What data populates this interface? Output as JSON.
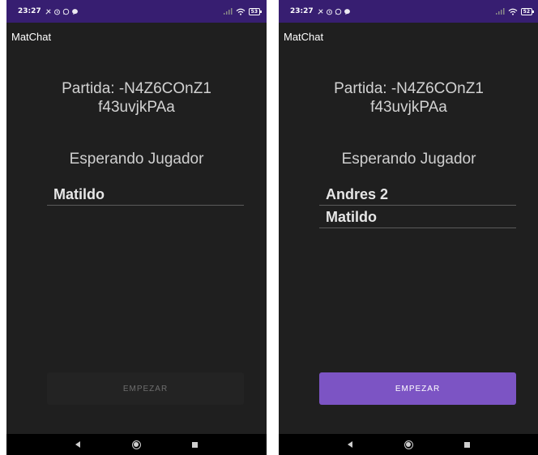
{
  "status_bar": {
    "left_time": "23:27",
    "right_time": "23:27",
    "left_battery": "53",
    "right_battery": "52",
    "color": "#371e71"
  },
  "app": {
    "title": "MatChat"
  },
  "match": {
    "line1": "Partida: -N4Z6COnZ1",
    "line2": "f43uvjkPAa"
  },
  "waiting_label": "Esperando Jugador",
  "left_screen": {
    "players": [
      "Matildo"
    ]
  },
  "right_screen": {
    "players": [
      "Andres 2",
      "Matildo"
    ]
  },
  "start_button": {
    "label": "EMPEZAR",
    "enabled_color": "#7c54c4",
    "disabled_color": "#232323"
  },
  "icons": {
    "back": "back-triangle-icon",
    "home": "home-circle-icon",
    "recents": "recents-square-icon"
  }
}
